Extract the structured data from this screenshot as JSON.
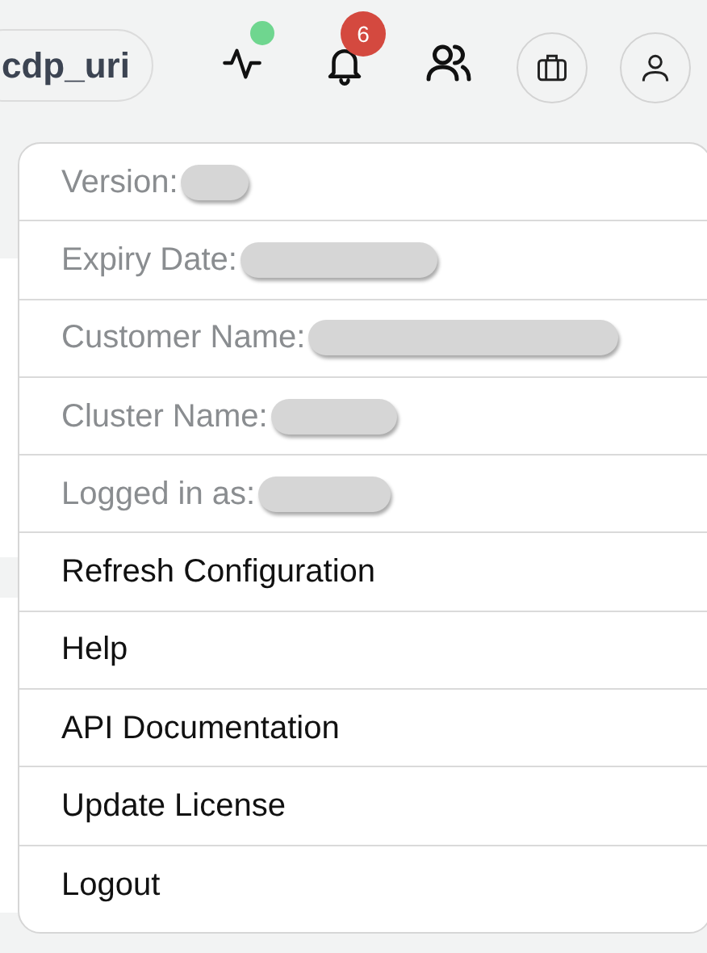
{
  "topbar": {
    "context_chip": "cdp_uri",
    "activity": {
      "online": true
    },
    "notifications": {
      "count": "6"
    }
  },
  "menu": {
    "info_items": [
      {
        "label": "Version:",
        "redacted": true
      },
      {
        "label": "Expiry Date:",
        "redacted": true
      },
      {
        "label": "Customer Name:",
        "redacted": true
      },
      {
        "label": "Cluster Name:",
        "redacted": true
      },
      {
        "label": "Logged in as:",
        "redacted": true
      }
    ],
    "actions": [
      "Refresh Configuration",
      "Help",
      "API Documentation",
      "Update License",
      "Logout"
    ]
  }
}
